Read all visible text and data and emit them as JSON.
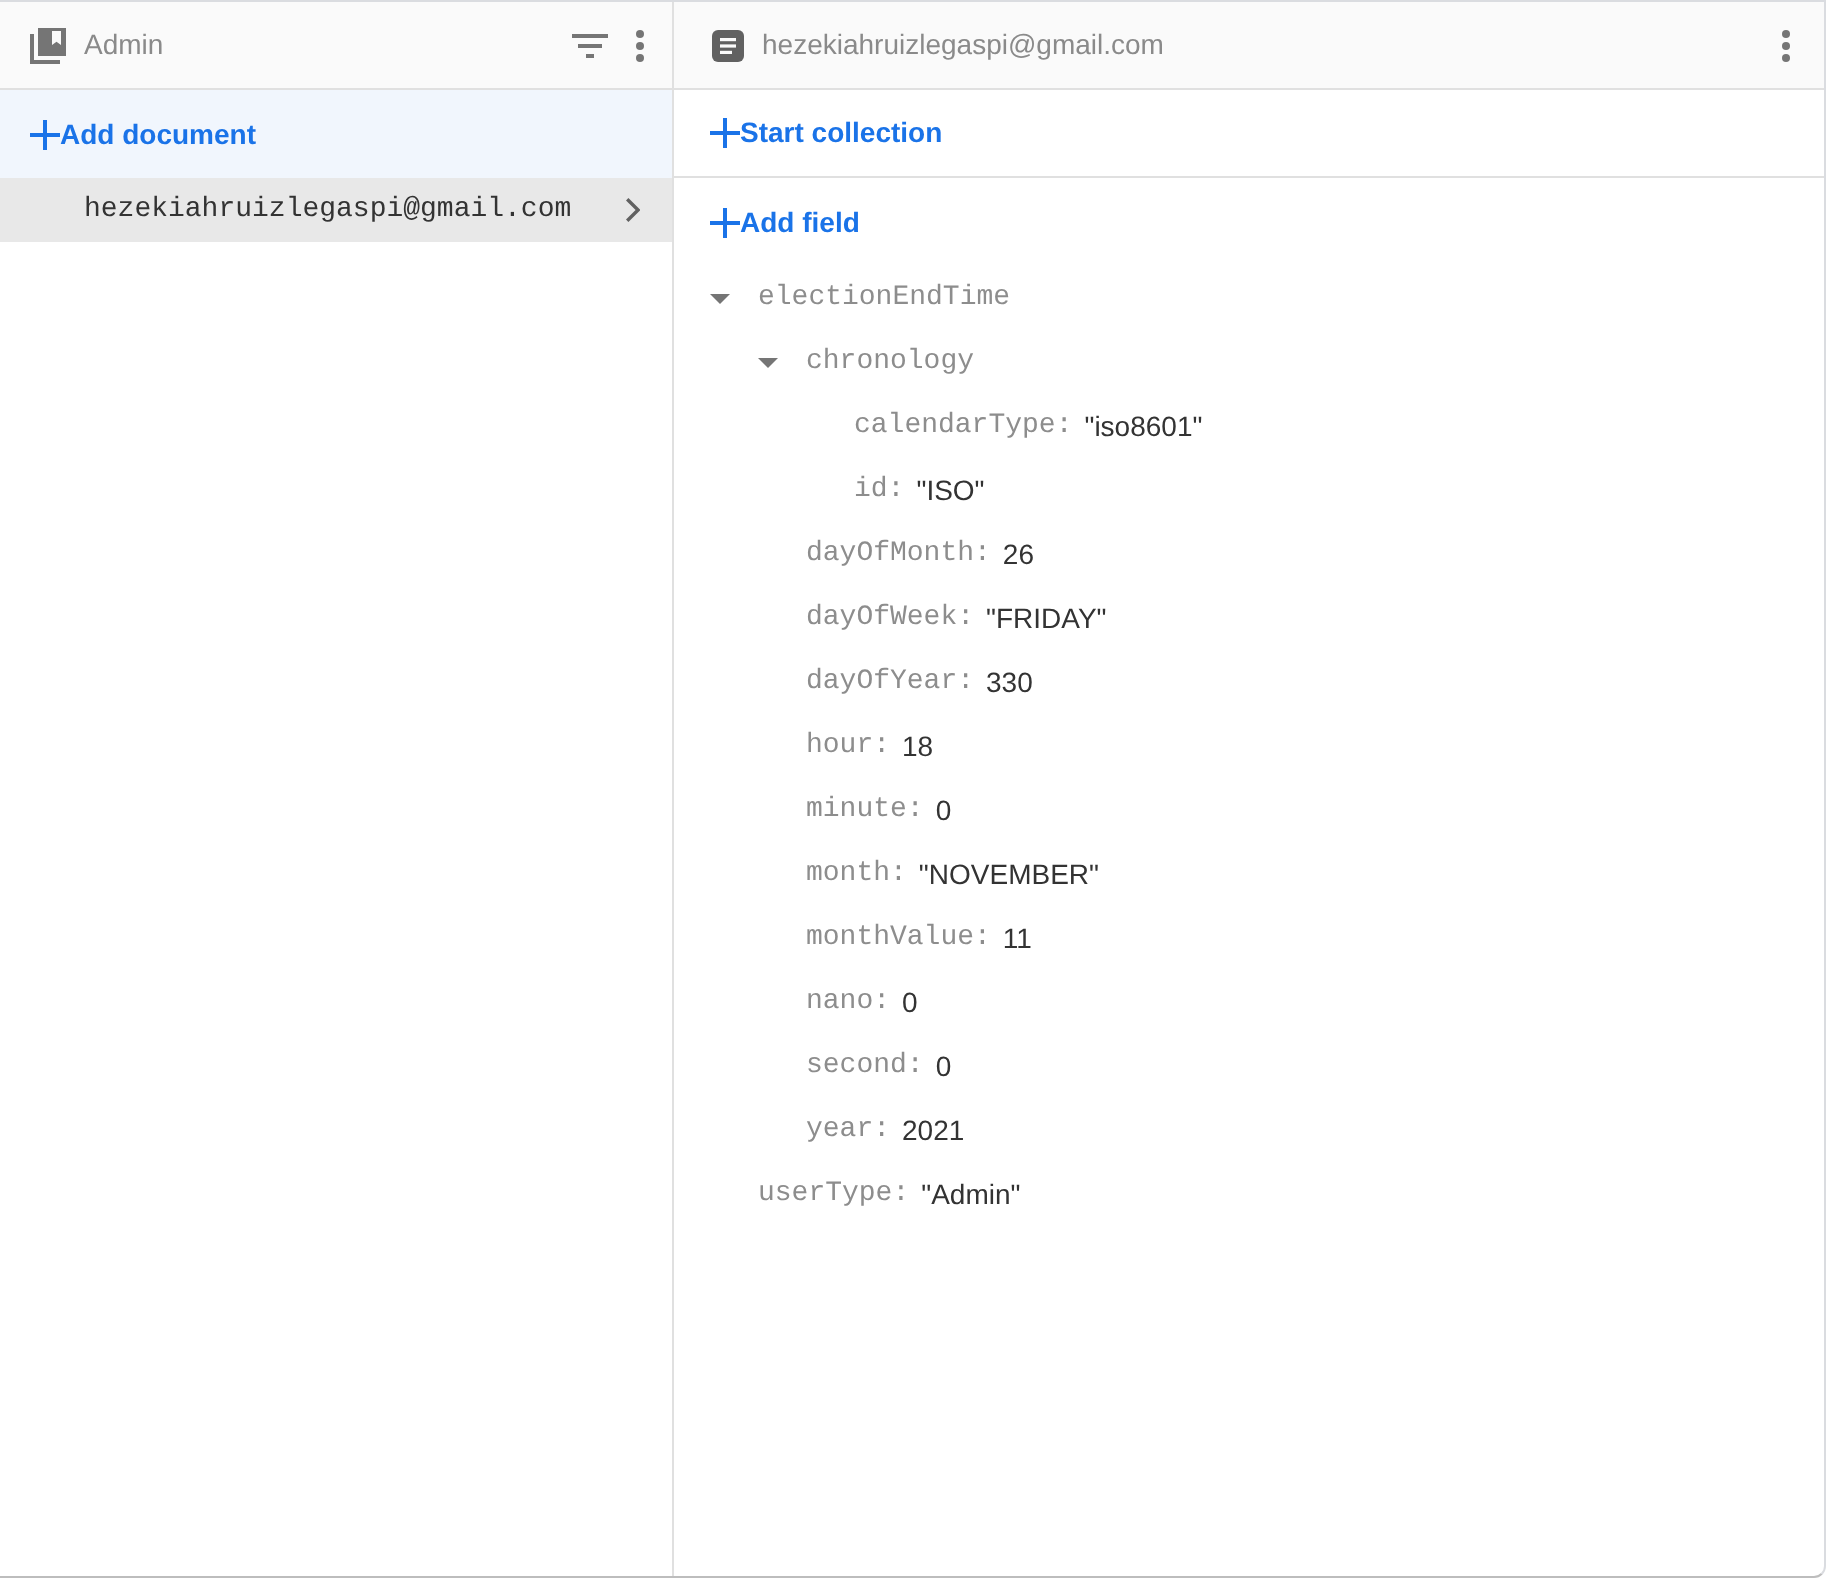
{
  "collection_panel": {
    "title": "Admin",
    "add_button": "Add document",
    "documents": [
      {
        "label": "hezekiahruizlegaspi@gmail.com",
        "selected": true
      }
    ]
  },
  "document_panel": {
    "title": "hezekiahruizlegaspi@gmail.com",
    "start_collection_button": "Start collection",
    "add_field_button": "Add field",
    "fields": [
      {
        "key": "electionEndTime",
        "expanded": true,
        "children": [
          {
            "key": "chronology",
            "expanded": true,
            "children": [
              {
                "key": "calendarType:",
                "value": "\"iso8601\""
              },
              {
                "key": "id:",
                "value": "\"ISO\""
              }
            ]
          },
          {
            "key": "dayOfMonth:",
            "value": "26"
          },
          {
            "key": "dayOfWeek:",
            "value": "\"FRIDAY\""
          },
          {
            "key": "dayOfYear:",
            "value": "330"
          },
          {
            "key": "hour:",
            "value": "18"
          },
          {
            "key": "minute:",
            "value": "0"
          },
          {
            "key": "month:",
            "value": "\"NOVEMBER\""
          },
          {
            "key": "monthValue:",
            "value": "11"
          },
          {
            "key": "nano:",
            "value": "0"
          },
          {
            "key": "second:",
            "value": "0"
          },
          {
            "key": "year:",
            "value": "2021"
          }
        ]
      },
      {
        "key": "userType:",
        "value": "\"Admin\""
      }
    ]
  }
}
